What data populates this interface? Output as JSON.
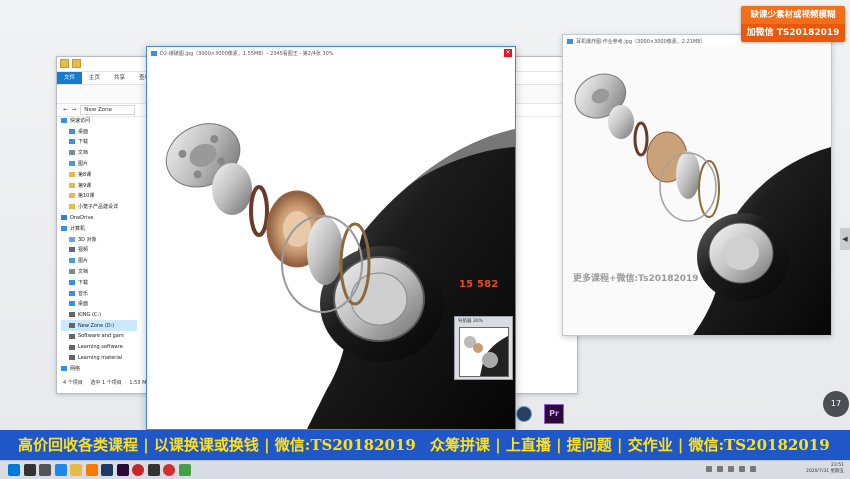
{
  "explorer": {
    "tabs": [
      "文件",
      "主页",
      "共享",
      "查看"
    ],
    "address": "New Zone",
    "nav_items": [
      {
        "label": "快速访问",
        "icon": "star-icon",
        "level": 0
      },
      {
        "label": "桌面",
        "icon": "desktop-icon",
        "level": 1
      },
      {
        "label": "下载",
        "icon": "download-icon",
        "level": 1
      },
      {
        "label": "文档",
        "icon": "document-icon",
        "level": 1
      },
      {
        "label": "图片",
        "icon": "picture-icon",
        "level": 1
      },
      {
        "label": "第8课",
        "icon": "folder-icon",
        "level": 1
      },
      {
        "label": "第9课",
        "icon": "folder-icon",
        "level": 1
      },
      {
        "label": "第10课",
        "icon": "folder-icon",
        "level": 1
      },
      {
        "label": "小笼子产品建设详",
        "icon": "folder-icon",
        "level": 1
      },
      {
        "label": "OneDrive",
        "icon": "cloud-icon",
        "level": 0
      },
      {
        "label": "计算机",
        "icon": "computer-icon",
        "level": 0
      },
      {
        "label": "3D 对象",
        "icon": "cube-icon",
        "level": 1
      },
      {
        "label": "视频",
        "icon": "video-icon",
        "level": 1
      },
      {
        "label": "图片",
        "icon": "picture-icon",
        "level": 1
      },
      {
        "label": "文档",
        "icon": "document-icon",
        "level": 1
      },
      {
        "label": "下载",
        "icon": "download-icon",
        "level": 1
      },
      {
        "label": "音乐",
        "icon": "music-icon",
        "level": 1
      },
      {
        "label": "桌面",
        "icon": "desktop-icon",
        "level": 1
      },
      {
        "label": "KING (C:)",
        "icon": "drive-icon",
        "level": 1
      },
      {
        "label": "New Zone (D:)",
        "icon": "drive-icon",
        "level": 1,
        "selected": true
      },
      {
        "label": "Software and gam",
        "icon": "drive-icon",
        "level": 1
      },
      {
        "label": "Learning software",
        "icon": "drive-icon",
        "level": 1
      },
      {
        "label": "Learning material",
        "icon": "drive-icon",
        "level": 1
      },
      {
        "label": "网络",
        "icon": "network-icon",
        "level": 0
      }
    ],
    "status": [
      "4 个项目",
      "选中 1 个项目",
      "1.53 MB"
    ]
  },
  "viewer1": {
    "title": "D2-爆破图.jpg（3000×3000像素，1.55MB）- 2345看图王 - 第2/4张 30%",
    "overlay_number": "15          582",
    "navigator_title": "导航器 30%"
  },
  "viewer2": {
    "title": "耳机爆炸图-作业参考.jpg（3000×3000像素，2.21MB）",
    "watermark": "更多课程+微信:Ts20182019"
  },
  "badge": {
    "line1": "缺课少素材或视频模糊",
    "line2": "加微信 TS20182019"
  },
  "banner": {
    "left": "高价回收各类课程 | 以课换课或换钱 | 微信:TS20182019",
    "right": "众筹拼课 | 上直播 | 提问题 | 交作业 | 微信:TS20182019"
  },
  "zoom_badge": "17",
  "side_arrow": "◀",
  "taskbar": {
    "apps": [
      "windows-icon",
      "search-icon",
      "task-view-icon",
      "edge-icon",
      "explorer-icon",
      "app-orange-icon",
      "photoshop-icon",
      "premiere-icon",
      "record-icon",
      "lr-icon",
      "netease-icon",
      "app-green-icon"
    ],
    "time": "23:51",
    "date": "2020/7/31 星期五"
  },
  "colors": {
    "banner_bg": "#1f57c8",
    "banner_text": "#ffe11a",
    "badge_bg": "#e8590c",
    "accent_blue": "#1979ca"
  }
}
